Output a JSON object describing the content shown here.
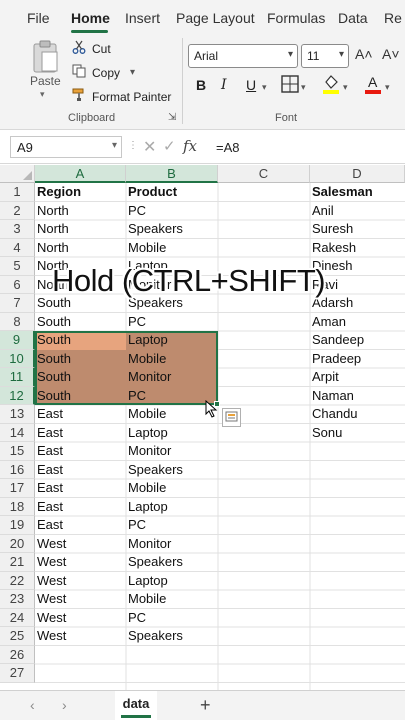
{
  "ribbon_tabs": [
    "File",
    "Home",
    "Insert",
    "Page Layout",
    "Formulas",
    "Data",
    "Re"
  ],
  "active_tab": "Home",
  "clipboard": {
    "paste": "Paste",
    "cut": "Cut",
    "copy": "Copy",
    "format_painter": "Format Painter",
    "group_label": "Clipboard"
  },
  "font": {
    "name": "Arial",
    "size": "11",
    "group_label": "Font",
    "bold": "B",
    "italic": "I",
    "underline": "U",
    "grow": "A˄",
    "shrink": "A˅",
    "font_color": "#e8190f",
    "fill_color": "#ffff00"
  },
  "formula_bar": {
    "name_box": "A9",
    "fx": "fx",
    "value": "=A8"
  },
  "columns": [
    "A",
    "B",
    "C",
    "D"
  ],
  "rows": [
    "1",
    "2",
    "3",
    "4",
    "5",
    "6",
    "7",
    "8",
    "9",
    "10",
    "11",
    "12",
    "13",
    "14",
    "15",
    "16",
    "17",
    "18",
    "19",
    "20",
    "21",
    "22",
    "23",
    "24",
    "25",
    "26",
    "27"
  ],
  "cells": {
    "A": [
      "Region",
      "North",
      "North",
      "North",
      "North",
      "North",
      "South",
      "South",
      "South",
      "South",
      "South",
      "South",
      "East",
      "East",
      "East",
      "East",
      "East",
      "East",
      "East",
      "West",
      "West",
      "West",
      "West",
      "West",
      "West",
      "",
      ""
    ],
    "B": [
      "Product",
      "PC",
      "Speakers",
      "Mobile",
      "Laptop",
      "Monitor",
      "Speakers",
      "PC",
      "Laptop",
      "Mobile",
      "Monitor",
      "PC",
      "Mobile",
      "Laptop",
      "Monitor",
      "Speakers",
      "Mobile",
      "Laptop",
      "PC",
      "Monitor",
      "Speakers",
      "Laptop",
      "Mobile",
      "PC",
      "Speakers",
      "",
      ""
    ],
    "D": [
      "Salesman",
      "Anil",
      "Suresh",
      "Rakesh",
      "Dinesh",
      "Ravi",
      "Adarsh",
      "Aman",
      "Sandeep",
      "Pradeep",
      "Arpit",
      "Naman",
      "Chandu",
      "Sonu",
      "",
      "",
      "",
      "",
      "",
      "",
      "",
      "",
      "",
      "",
      "",
      "",
      ""
    ]
  },
  "overlay_caption": "Hold (CTRL+SHIFT)",
  "sheet_tab": "data",
  "add_sheet": "+",
  "highlight_colors": {
    "light": "#e7a47e",
    "dark": "#be8b6e",
    "selection": "#217346"
  }
}
